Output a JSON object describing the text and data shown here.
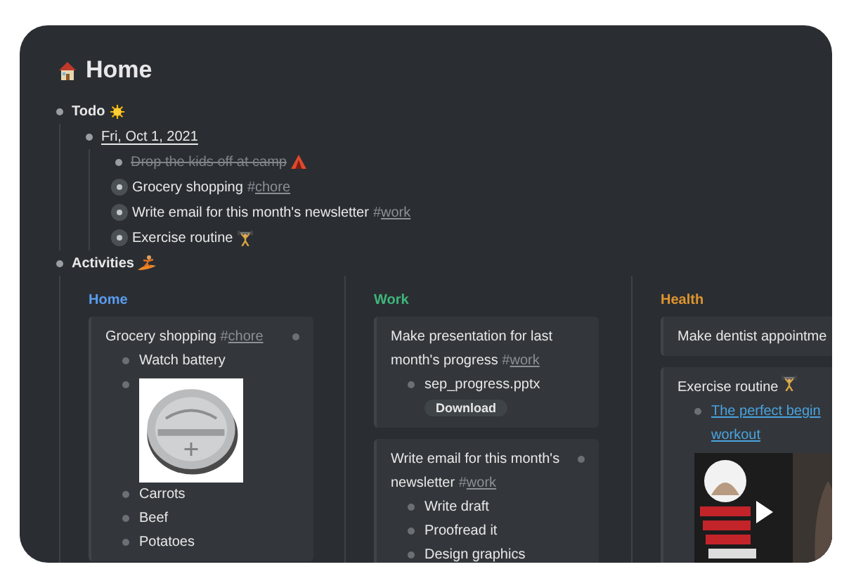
{
  "title": "Home",
  "todo": {
    "label": "Todo",
    "date": "Fri, Oct 1, 2021",
    "items": [
      {
        "kind": "task",
        "text": "Drop the kids off at camp",
        "done": true
      },
      {
        "kind": "ref",
        "text": "Grocery shopping",
        "tag": "#chore"
      },
      {
        "kind": "ref",
        "text": "Write email for this month's newsletter",
        "tag": "#work"
      },
      {
        "kind": "ref",
        "text": "Exercise routine"
      }
    ]
  },
  "activities": {
    "label": "Activities",
    "columns": [
      {
        "heading": "Home",
        "color": "#5b9cf0",
        "cards": [
          {
            "text": "Grocery shopping",
            "tag": "#chore",
            "referenced": true,
            "children": [
              {
                "kind": "text",
                "text": "Watch battery"
              },
              {
                "kind": "picture"
              },
              {
                "kind": "text",
                "text": "Carrots"
              },
              {
                "kind": "text",
                "text": "Beef"
              },
              {
                "kind": "text",
                "text": "Potatoes"
              }
            ]
          }
        ]
      },
      {
        "heading": "Work",
        "color": "#3fb67a",
        "cards": [
          {
            "text": "Make presentation for last month's progress",
            "tag": "#work",
            "referenced": false,
            "children": [
              {
                "kind": "file",
                "text": "sep_progress.pptx",
                "button": "Download"
              }
            ]
          },
          {
            "text": "Write email for this month's newsletter",
            "tag": "#work",
            "referenced": true,
            "children": [
              {
                "kind": "text",
                "text": "Write draft"
              },
              {
                "kind": "text",
                "text": "Proofread it"
              },
              {
                "kind": "text",
                "text": "Design graphics"
              }
            ]
          }
        ]
      },
      {
        "heading": "Health",
        "color": "#e0952e",
        "cards": [
          {
            "text": "Make dentist appointme"
          },
          {
            "text": "Exercise routine",
            "children": [
              {
                "kind": "link",
                "lines": [
                  "The perfect begin",
                  "workout"
                ]
              },
              {
                "kind": "video"
              }
            ]
          }
        ]
      }
    ]
  }
}
